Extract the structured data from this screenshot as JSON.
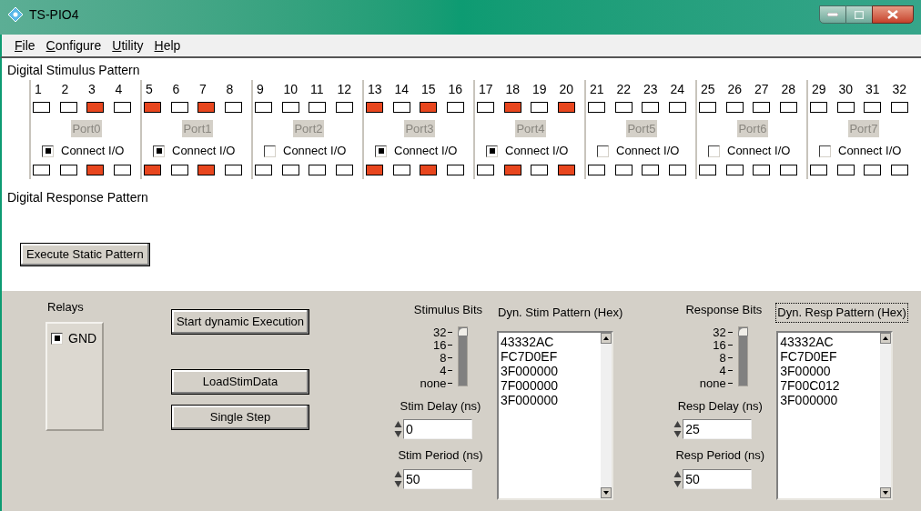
{
  "window": {
    "title": "TS-PIO4"
  },
  "menu": [
    "File",
    "Configure",
    "Utility",
    "Help"
  ],
  "stimulus_title": "Digital Stimulus Pattern",
  "ports": [
    {
      "label": "Port0",
      "connect_label": "Connect I/O",
      "connect_checked": true,
      "bits": [
        {
          "number": "1",
          "stim_on": false,
          "resp_on": false
        },
        {
          "number": "2",
          "stim_on": false,
          "resp_on": false
        },
        {
          "number": "3",
          "stim_on": true,
          "resp_on": true
        },
        {
          "number": "4",
          "stim_on": false,
          "resp_on": false
        }
      ]
    },
    {
      "label": "Port1",
      "connect_label": "Connect I/O",
      "connect_checked": true,
      "bits": [
        {
          "number": "5",
          "stim_on": true,
          "resp_on": true
        },
        {
          "number": "6",
          "stim_on": false,
          "resp_on": false
        },
        {
          "number": "7",
          "stim_on": true,
          "resp_on": true
        },
        {
          "number": "8",
          "stim_on": false,
          "resp_on": false
        }
      ]
    },
    {
      "label": "Port2",
      "connect_label": "Connect I/O",
      "connect_checked": false,
      "bits": [
        {
          "number": "9",
          "stim_on": false,
          "resp_on": false
        },
        {
          "number": "10",
          "stim_on": false,
          "resp_on": false
        },
        {
          "number": "11",
          "stim_on": false,
          "resp_on": false
        },
        {
          "number": "12",
          "stim_on": false,
          "resp_on": false
        }
      ]
    },
    {
      "label": "Port3",
      "connect_label": "Connect I/O",
      "connect_checked": true,
      "bits": [
        {
          "number": "13",
          "stim_on": true,
          "resp_on": true
        },
        {
          "number": "14",
          "stim_on": false,
          "resp_on": false
        },
        {
          "number": "15",
          "stim_on": true,
          "resp_on": true
        },
        {
          "number": "16",
          "stim_on": false,
          "resp_on": false
        }
      ]
    },
    {
      "label": "Port4",
      "connect_label": "Connect I/O",
      "connect_checked": true,
      "bits": [
        {
          "number": "17",
          "stim_on": false,
          "resp_on": false
        },
        {
          "number": "18",
          "stim_on": true,
          "resp_on": true
        },
        {
          "number": "19",
          "stim_on": false,
          "resp_on": false
        },
        {
          "number": "20",
          "stim_on": true,
          "resp_on": true
        }
      ]
    },
    {
      "label": "Port5",
      "connect_label": "Connect I/O",
      "connect_checked": false,
      "bits": [
        {
          "number": "21",
          "stim_on": false,
          "resp_on": false
        },
        {
          "number": "22",
          "stim_on": false,
          "resp_on": false
        },
        {
          "number": "23",
          "stim_on": false,
          "resp_on": false
        },
        {
          "number": "24",
          "stim_on": false,
          "resp_on": false
        }
      ]
    },
    {
      "label": "Port6",
      "connect_label": "Connect I/O",
      "connect_checked": false,
      "bits": [
        {
          "number": "25",
          "stim_on": false,
          "resp_on": false
        },
        {
          "number": "26",
          "stim_on": false,
          "resp_on": false
        },
        {
          "number": "27",
          "stim_on": false,
          "resp_on": false
        },
        {
          "number": "28",
          "stim_on": false,
          "resp_on": false
        }
      ]
    },
    {
      "label": "Port7",
      "connect_label": "Connect I/O",
      "connect_checked": false,
      "bits": [
        {
          "number": "29",
          "stim_on": false,
          "resp_on": false
        },
        {
          "number": "30",
          "stim_on": false,
          "resp_on": false
        },
        {
          "number": "31",
          "stim_on": false,
          "resp_on": false
        },
        {
          "number": "32",
          "stim_on": false,
          "resp_on": false
        }
      ]
    }
  ],
  "response_title": "Digital Response Pattern",
  "execute_button": "Execute Static Pattern",
  "relays": {
    "title": "Relays",
    "items": [
      {
        "label": "GND",
        "checked": true
      }
    ]
  },
  "buttons": [
    "Start dynamic Execution",
    "LoadStimData",
    "Single Step"
  ],
  "stimulus": {
    "bits_title": "Stimulus Bits",
    "scale": [
      "32",
      "16",
      "8",
      "4",
      "none"
    ],
    "level": 1,
    "delay_label": "Stim Delay (ns)",
    "delay_value": "0",
    "period_label": "Stim Period (ns)",
    "period_value": "50",
    "pattern_title": "Dyn. Stim Pattern (Hex)",
    "pattern_focused": false,
    "pattern_lines": [
      "43332AC",
      "FC7D0EF",
      "3F000000",
      "7F000000",
      "3F000000"
    ]
  },
  "response": {
    "bits_title": "Response Bits",
    "scale": [
      "32",
      "16",
      "8",
      "4",
      "none"
    ],
    "level": 1,
    "delay_label": "Resp Delay (ns)",
    "delay_value": "25",
    "period_label": "Resp Period (ns)",
    "period_value": "50",
    "pattern_title": "Dyn. Resp Pattern (Hex)",
    "pattern_focused": true,
    "pattern_lines": [
      "43332AC",
      "FC7D0EF",
      "3F00000",
      "7F00C012",
      "3F000000"
    ]
  }
}
